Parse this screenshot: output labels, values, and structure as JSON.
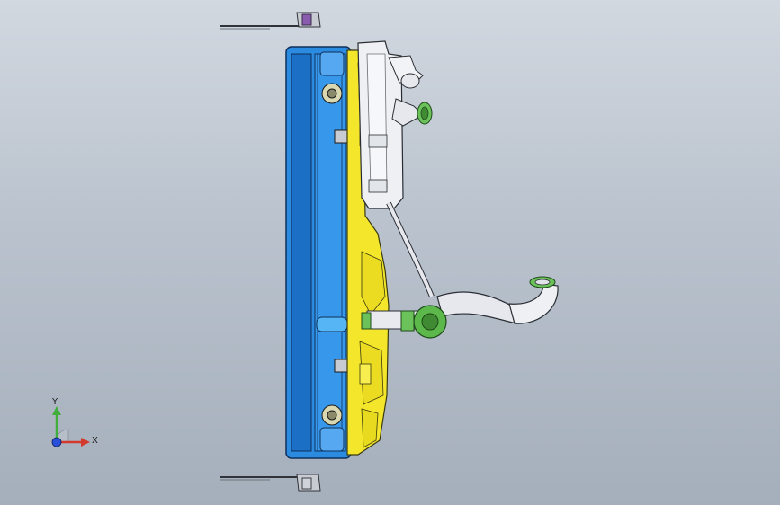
{
  "viewport": {
    "background_top": "#d2d8e0",
    "background_bottom": "#a5afbb"
  },
  "model": {
    "parts": [
      {
        "name": "radiator-core",
        "color": "#2a7fd4"
      },
      {
        "name": "radiator-tank",
        "color": "#1f6fc0"
      },
      {
        "name": "fan-shroud",
        "color": "#f5ea2a"
      },
      {
        "name": "expansion-tank",
        "color": "#eef0f4"
      },
      {
        "name": "coolant-hose",
        "color": "#e6e8ee"
      },
      {
        "name": "hose-clamp",
        "color": "#57b84a"
      },
      {
        "name": "mount-bracket",
        "color": "#c8ccd2"
      },
      {
        "name": "bracket-accent",
        "color": "#7a4fa0"
      }
    ]
  },
  "triad": {
    "y_label": "Y",
    "x_label": "X",
    "y_color": "#3fae3a",
    "x_color": "#d23a2e",
    "z_color": "#2a4fd8"
  }
}
